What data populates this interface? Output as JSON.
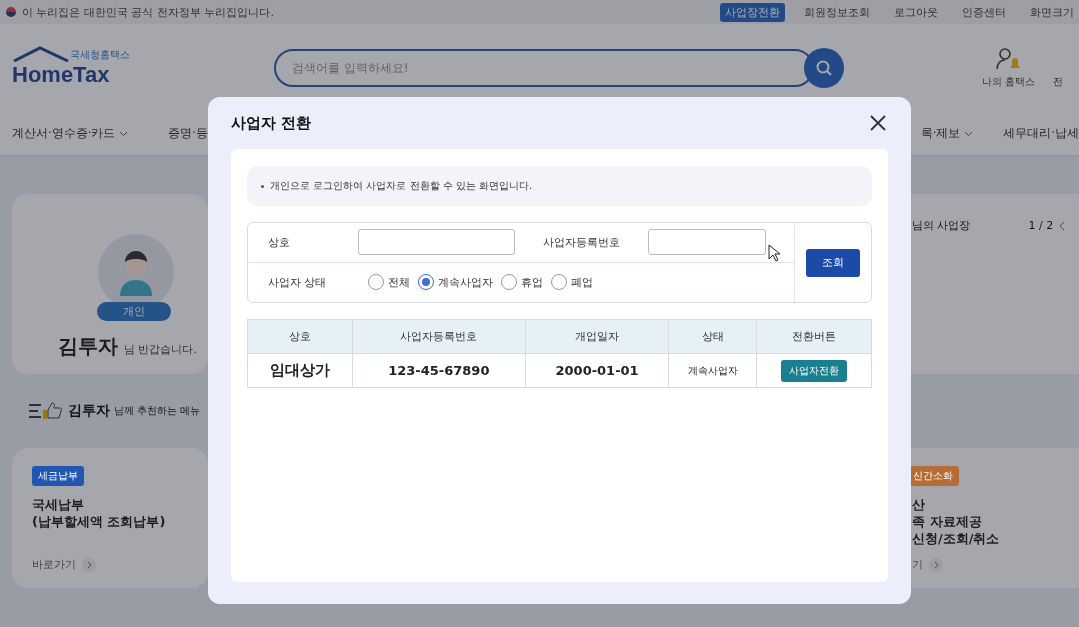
{
  "top_bar": {
    "notice": "이 누리집은 대한민국 공식 전자정부 누리집입니다.",
    "links": [
      {
        "label": "사업장전환",
        "highlighted": true
      },
      {
        "label": "회원정보조회",
        "highlighted": false
      },
      {
        "label": "로그아웃",
        "highlighted": false
      },
      {
        "label": "인증센터",
        "highlighted": false
      },
      {
        "label": "화면크기",
        "highlighted": false
      }
    ]
  },
  "header": {
    "logo_sub": "국세청홈택스",
    "logo": "HomeTax",
    "search_placeholder": "검색어를 입력하세요!",
    "my_label": "나의 홈택스",
    "cut_label": "전"
  },
  "nav": [
    "계산서·영수증·카드",
    "증명·등",
    "록·제보",
    "세무대리·납세"
  ],
  "profile": {
    "badge": "개인",
    "name": "김투자",
    "greeting": "님 반갑습니다."
  },
  "recommend": {
    "name": "김투자",
    "text": "님께 추천하는 메뉴"
  },
  "cards": [
    {
      "tag": "세금납부",
      "color": "#2157b3",
      "lines": [
        "국세납부",
        "(납부할세액 조회납부)"
      ],
      "link": "바로가기"
    },
    {
      "tag": "신간소화",
      "color": "#b56d35",
      "lines": [
        "산",
        "족 자료제공",
        "신청/조회/취소"
      ],
      "link": "기"
    }
  ],
  "business": {
    "title": "님의 사업장",
    "page": "1 / 2"
  },
  "modal": {
    "title": "사업자 전환",
    "notice": "개인으로 로그인하여 사업자로 전환할 수 있는 화면입니다.",
    "search": {
      "fields": [
        {
          "label": "상호"
        },
        {
          "label": "사업자등록번호"
        }
      ],
      "status_label": "사업자 상태",
      "options": [
        {
          "label": "전체",
          "selected": false
        },
        {
          "label": "계속사업자",
          "selected": true
        },
        {
          "label": "휴업",
          "selected": false
        },
        {
          "label": "폐업",
          "selected": false
        }
      ],
      "button": "조회"
    },
    "table": {
      "columns": [
        "상호",
        "사업자등록번호",
        "개업일자",
        "상태",
        "전환버튼"
      ],
      "rows": [
        {
          "name": "임대상가",
          "reg_no": "123-45-67890",
          "open_date": "2000-01-01",
          "status": "계속사업자",
          "action": "사업자전환"
        }
      ]
    }
  }
}
